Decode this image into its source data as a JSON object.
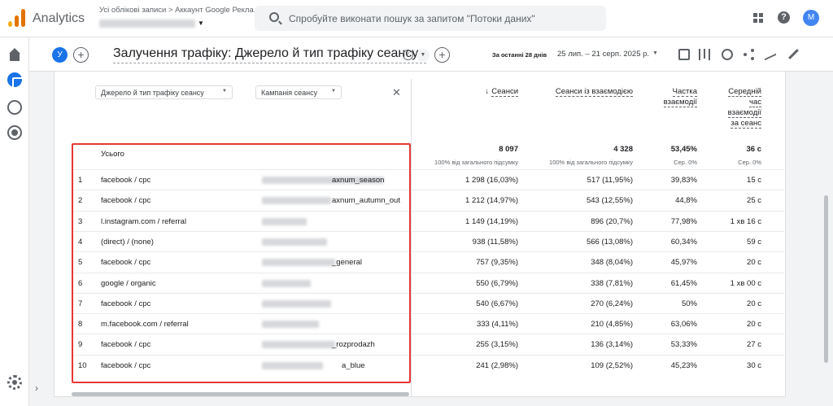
{
  "topbar": {
    "app_title": "Analytics",
    "breadcrumb": "Усі облікові записи > Аккаунт Google Рекла...",
    "search_placeholder": "Спробуйте виконати пошук за запитом \"Потоки даних\"",
    "avatar_letter": "M"
  },
  "report": {
    "segment_letter": "У",
    "title": "Залучення трафіку: Джерело й тип трафіку сеансу",
    "date_label": "За останні 28 днів",
    "date_range": "25 лип. – 21 серп. 2025 р."
  },
  "table": {
    "dim1_label": "Джерело й тип трафіку сеансу",
    "dim2_label": "Кампанія сеансу",
    "metric_headers": [
      "Сеанси",
      "Сеанси із взаємодією",
      "Частка взаємодії",
      "Середній час взаємодії за сеанс"
    ],
    "totals_label": "Усього",
    "totals": [
      "8 097",
      "4 328",
      "53,45%",
      "36 с"
    ],
    "totals_sub": [
      "100% від загального підсумку",
      "100% від загального підсумку",
      "Сер. 0%",
      "Сер. 0%"
    ],
    "rows": [
      {
        "n": "1",
        "src": "facebook / cpc",
        "cmp": "axnum_season",
        "s": "1 298 (16,03%)",
        "e": "517 (11,95%)",
        "r": "39,83%",
        "t": "15 с"
      },
      {
        "n": "2",
        "src": "facebook / cpc",
        "cmp": "axnum_autumn_out",
        "s": "1 212 (14,97%)",
        "e": "543 (12,55%)",
        "r": "44,8%",
        "t": "25 с"
      },
      {
        "n": "3",
        "src": "l.instagram.com / referral",
        "cmp": "",
        "s": "1 149 (14,19%)",
        "e": "896 (20,7%)",
        "r": "77,98%",
        "t": "1 хв 16 с"
      },
      {
        "n": "4",
        "src": "(direct) / (none)",
        "cmp": "",
        "s": "938 (11,58%)",
        "e": "566 (13,08%)",
        "r": "60,34%",
        "t": "59 с"
      },
      {
        "n": "5",
        "src": "facebook / cpc",
        "cmp": "_general",
        "s": "757 (9,35%)",
        "e": "348 (8,04%)",
        "r": "45,97%",
        "t": "20 с"
      },
      {
        "n": "6",
        "src": "google / organic",
        "cmp": "",
        "s": "550 (6,79%)",
        "e": "338 (7,81%)",
        "r": "61,45%",
        "t": "1 хв 00 с"
      },
      {
        "n": "7",
        "src": "facebook / cpc",
        "cmp": "",
        "s": "540 (6,67%)",
        "e": "270 (6,24%)",
        "r": "50%",
        "t": "20 с"
      },
      {
        "n": "8",
        "src": "m.facebook.com / referral",
        "cmp": "",
        "s": "333 (4,11%)",
        "e": "210 (4,85%)",
        "r": "63,06%",
        "t": "20 с"
      },
      {
        "n": "9",
        "src": "facebook / cpc",
        "cmp": "_rozprodazh",
        "s": "255 (3,15%)",
        "e": "136 (3,14%)",
        "r": "53,33%",
        "t": "27 с"
      },
      {
        "n": "10",
        "src": "facebook / cpc",
        "cmp": "a_blue",
        "s": "241 (2,98%)",
        "e": "109 (2,52%)",
        "r": "45,23%",
        "t": "30 с"
      }
    ]
  }
}
